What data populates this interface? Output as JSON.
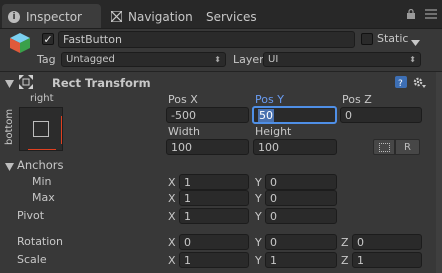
{
  "tabs": [
    {
      "label": "Inspector",
      "icon": "info-icon",
      "active": true
    },
    {
      "label": "Navigation",
      "icon": "navigation-icon",
      "active": false
    },
    {
      "label": "Services",
      "icon": "",
      "active": false
    }
  ],
  "gameobject": {
    "active": true,
    "name": "FastButton",
    "static_label": "Static",
    "static_checked": false,
    "tag_label": "Tag",
    "tag_value": "Untagged",
    "layer_label": "Layer",
    "layer_value": "UI"
  },
  "rect_transform": {
    "title": "Rect Transform",
    "anchor_preset": {
      "top_label": "right",
      "side_label": "bottom"
    },
    "pos_x_label": "Pos X",
    "pos_x": "-500",
    "pos_y_label": "Pos Y",
    "pos_y": "50",
    "pos_z_label": "Pos Z",
    "pos_z": "0",
    "width_label": "Width",
    "width": "100",
    "height_label": "Height",
    "height": "100",
    "raw_button": "R",
    "anchors_label": "Anchors",
    "min_label": "Min",
    "min_x": "1",
    "min_y": "0",
    "max_label": "Max",
    "max_x": "1",
    "max_y": "0",
    "pivot_label": "Pivot",
    "pivot_x": "1",
    "pivot_y": "0",
    "rotation_label": "Rotation",
    "rot_x": "0",
    "rot_y": "0",
    "rot_z": "0",
    "scale_label": "Scale",
    "scale_x": "1",
    "scale_y": "1",
    "scale_z": "1",
    "x_axis": "X",
    "y_axis": "Y",
    "z_axis": "Z"
  },
  "colors": {
    "background": "#383838",
    "field": "#2a2a2a",
    "accent": "#4f8fe6"
  }
}
